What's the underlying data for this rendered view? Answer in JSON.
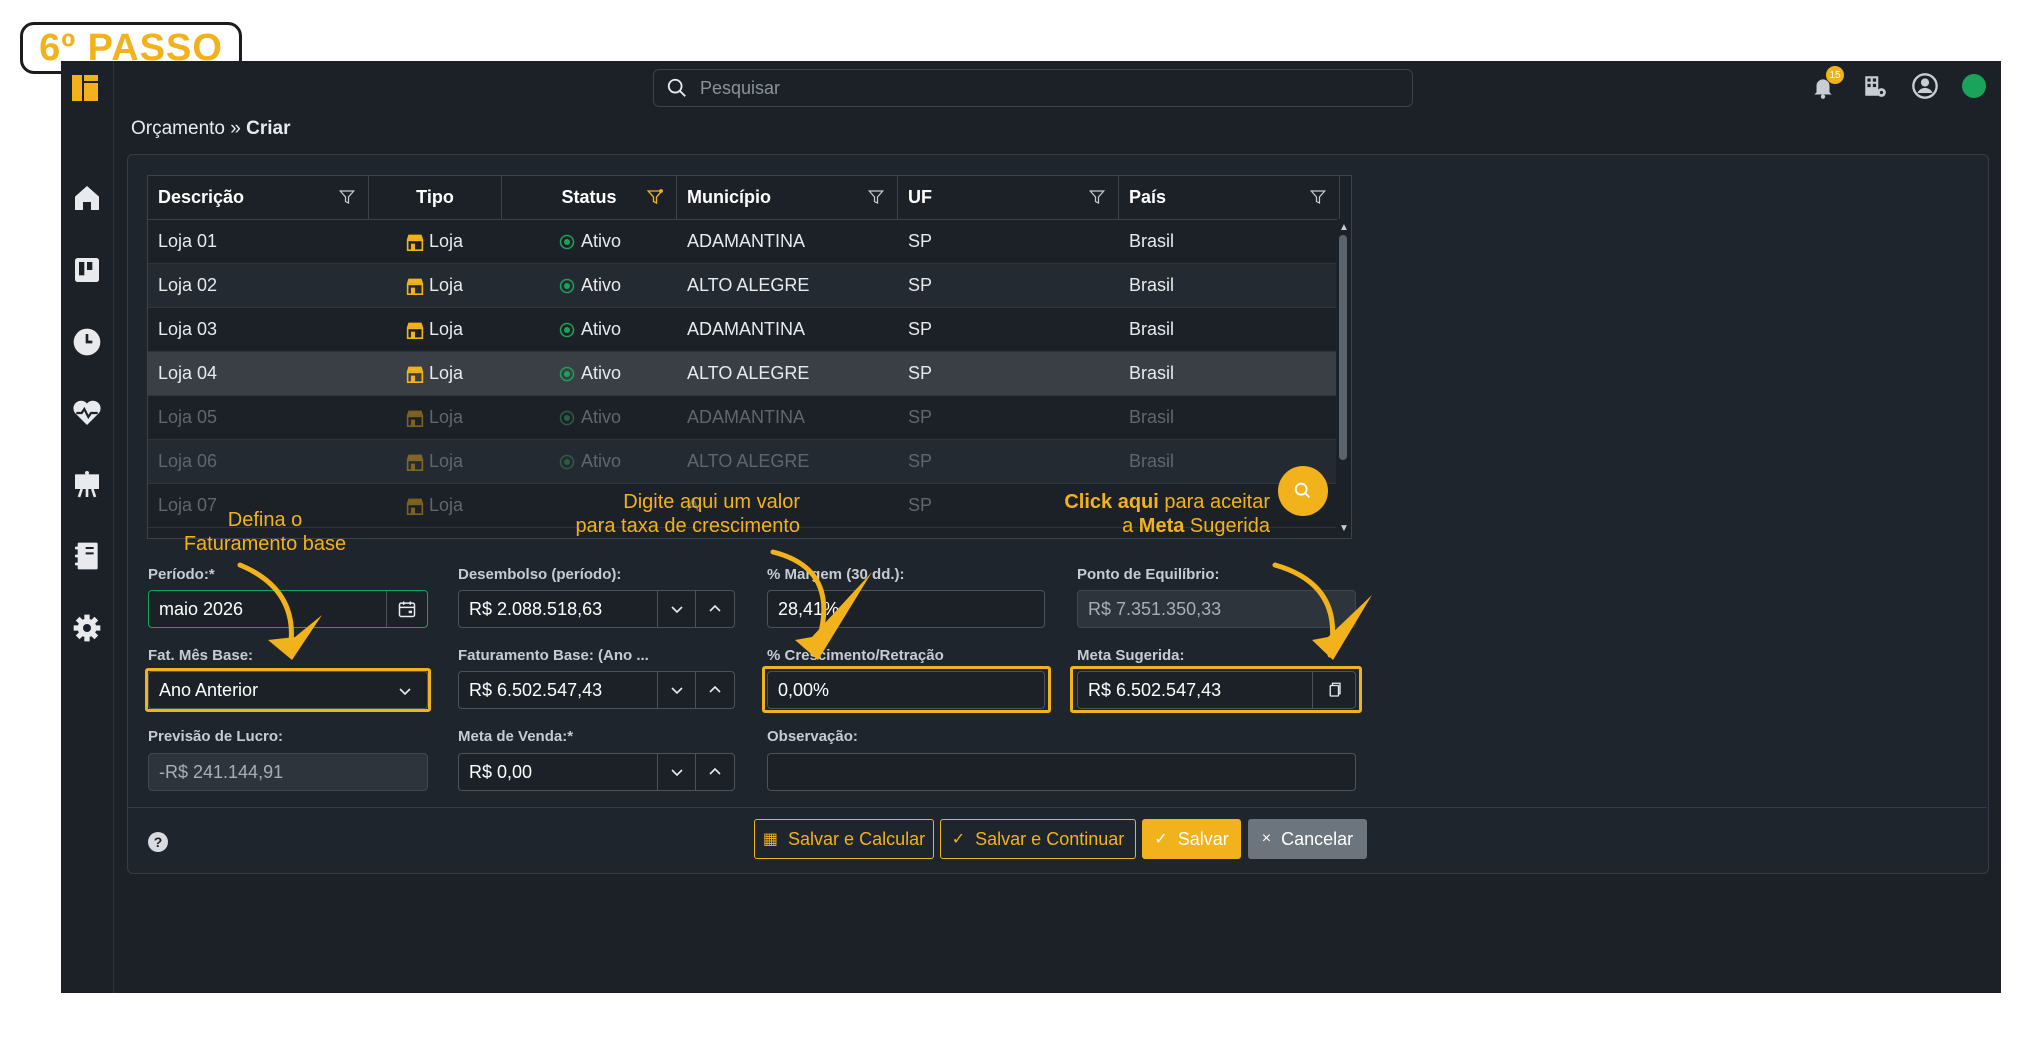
{
  "step_badge": "6º PASSO",
  "topbar": {
    "search_placeholder": "Pesquisar",
    "notification_count": "15"
  },
  "breadcrumb": {
    "parent": "Orçamento",
    "separator": " » ",
    "current": "Criar"
  },
  "table": {
    "headers": [
      "Descrição",
      "Tipo",
      "Status",
      "Município",
      "UF",
      "País"
    ],
    "rows": [
      {
        "descricao": "Loja 01",
        "tipo": "Loja",
        "status": "Ativo",
        "municipio": "ADAMANTINA",
        "uf": "SP",
        "pais": "Brasil"
      },
      {
        "descricao": "Loja 02",
        "tipo": "Loja",
        "status": "Ativo",
        "municipio": "ALTO ALEGRE",
        "uf": "SP",
        "pais": "Brasil"
      },
      {
        "descricao": "Loja 03",
        "tipo": "Loja",
        "status": "Ativo",
        "municipio": "ADAMANTINA",
        "uf": "SP",
        "pais": "Brasil"
      },
      {
        "descricao": "Loja 04",
        "tipo": "Loja",
        "status": "Ativo",
        "municipio": "ALTO ALEGRE",
        "uf": "SP",
        "pais": "Brasil"
      },
      {
        "descricao": "Loja 05",
        "tipo": "Loja",
        "status": "Ativo",
        "municipio": "ADAMANTINA",
        "uf": "SP",
        "pais": "Brasil"
      },
      {
        "descricao": "Loja 06",
        "tipo": "Loja",
        "status": "Ativo",
        "municipio": "ALTO ALEGRE",
        "uf": "SP",
        "pais": "Brasil"
      },
      {
        "descricao": "Loja 07",
        "tipo": "Loja",
        "status": "",
        "municipio": "A",
        "uf": "SP",
        "pais": ""
      }
    ]
  },
  "form": {
    "periodo": {
      "label": "Período:*",
      "value": "maio 2026"
    },
    "desembolso": {
      "label": "Desembolso (período):",
      "value": "R$ 2.088.518,63"
    },
    "margem": {
      "label": "% Margem (30 dd.):",
      "value": "28,41%"
    },
    "ponto_equilibrio": {
      "label": "Ponto de Equilíbrio:",
      "value": "R$ 7.351.350,33"
    },
    "fat_mes_base": {
      "label": "Fat. Mês Base:",
      "value": "Ano Anterior"
    },
    "faturamento_base": {
      "label": "Faturamento Base: (Ano ...",
      "value": "R$ 6.502.547,43"
    },
    "crescimento": {
      "label": "% Crescimento/Retração",
      "value": "0,00%"
    },
    "meta_sugerida": {
      "label": "Meta Sugerida:",
      "value": "R$ 6.502.547,43"
    },
    "previsao_lucro": {
      "label": "Previsão de Lucro:",
      "value": "-R$ 241.144,91"
    },
    "meta_venda": {
      "label": "Meta de Venda:*",
      "value": "R$ 0,00"
    },
    "observacao": {
      "label": "Observação:",
      "value": ""
    }
  },
  "buttons": {
    "salvar_calcular": "Salvar e Calcular",
    "salvar_continuar": "Salvar e Continuar",
    "salvar": "Salvar",
    "cancelar": "Cancelar"
  },
  "annotations": {
    "a1_line1": "Defina o",
    "a1_line2": "Faturamento base",
    "a2_line1": "Digite aqui um valor",
    "a2_line2": "para taxa de crescimento",
    "a3_click": "Click aqui",
    "a3_rest1": " para  aceitar",
    "a3_prefix2": "a ",
    "a3_meta": "Meta",
    "a3_rest2": " Sugerida"
  },
  "colors": {
    "accent": "#f2b21b",
    "background": "#1c2127",
    "status_green": "#1aa35a"
  }
}
